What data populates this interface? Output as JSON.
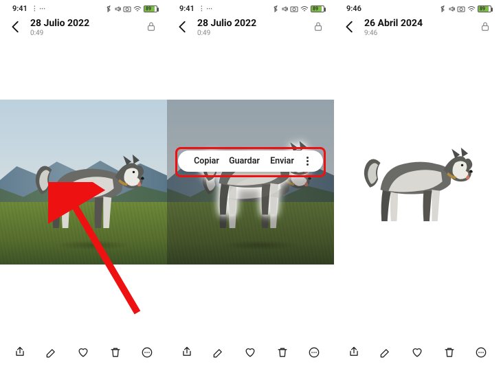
{
  "panels": [
    {
      "status_time": "9:41",
      "status_extra": "⋮ ⋯",
      "header_date": "28 Julio 2022",
      "header_time": "0:49",
      "battery_pct": "89"
    },
    {
      "status_time": "9:41",
      "status_extra": "⋮ ⋯",
      "header_date": "28 Julio 2022",
      "header_time": "0:49",
      "battery_pct": "89",
      "menu": {
        "copy": "Copiar",
        "save": "Guardar",
        "send": "Enviar"
      }
    },
    {
      "status_time": "9:46",
      "status_extra": "",
      "header_date": "26 Abril 2024",
      "header_time": "9:46",
      "battery_pct": "89"
    }
  ]
}
